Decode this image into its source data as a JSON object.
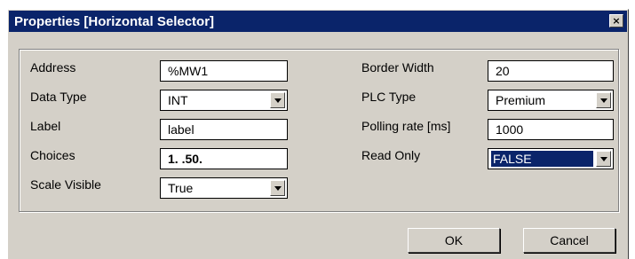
{
  "dialog": {
    "title": "Properties [Horizontal Selector]",
    "close_label": "×"
  },
  "left": {
    "address_label": "Address",
    "address_value": "%MW1",
    "datatype_label": "Data Type",
    "datatype_value": "INT",
    "label_label": "Label",
    "label_value": "label",
    "choices_label": "Choices",
    "choices_value": "1. .50.",
    "scale_label": "Scale Visible",
    "scale_value": "True"
  },
  "right": {
    "border_label": "Border Width",
    "border_value": "20",
    "plctype_label": "PLC Type",
    "plctype_value": "Premium",
    "polling_label": "Polling rate [ms]",
    "polling_value": "1000",
    "readonly_label": "Read Only",
    "readonly_value": "FALSE"
  },
  "buttons": {
    "ok": "OK",
    "cancel": "Cancel"
  },
  "colors": {
    "titlebar": "#0a246a",
    "face": "#d4d0c8",
    "selection": "#0a246a"
  },
  "icons": {
    "close": "close-icon",
    "dropdown": "chevron-down-icon"
  }
}
